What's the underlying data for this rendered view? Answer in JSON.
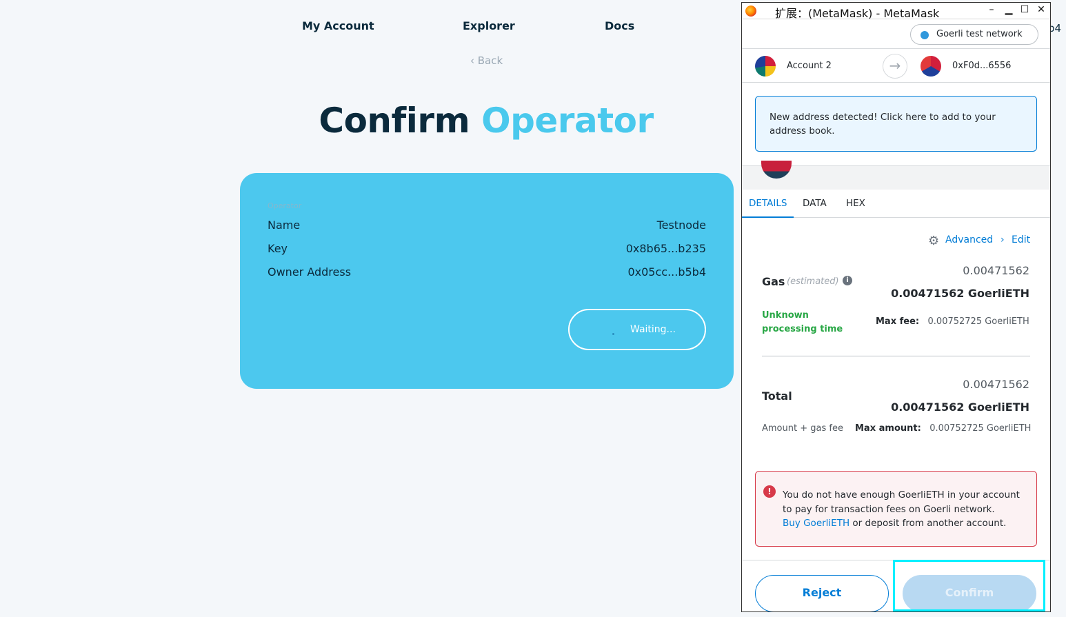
{
  "nav": {
    "my_account": "My Account",
    "explorer": "Explorer",
    "docs": "Docs",
    "back": "‹ Back"
  },
  "hero": {
    "word1": "Confirm",
    "word2": "Operator"
  },
  "card": {
    "section_label": "Operator",
    "rows": [
      {
        "key": "Name",
        "value": "Testnode"
      },
      {
        "key": "Key",
        "value": "0x8b65...b235"
      },
      {
        "key": "Owner Address",
        "value": "0x05cc...b5b4"
      }
    ],
    "waiting_label": "Waiting..."
  },
  "edge_text": "b4",
  "popup": {
    "title": "扩展：(MetaMask) - MetaMask",
    "controls": {
      "minimize": "–",
      "restore": "▁",
      "maximize": "☐",
      "close": "✕"
    },
    "network": "Goerli test network",
    "from_account": "Account 2",
    "to_account": "0xF0d...6556",
    "new_address_alert": "New address detected! Click here to add to your address book.",
    "tabs": [
      "DETAILS",
      "DATA",
      "HEX"
    ],
    "advanced": "Advanced",
    "edit": "Edit",
    "gas": {
      "label": "Gas",
      "estimated": "(estimated)",
      "value_fiat": "0.00471562",
      "value_eth": "0.00471562 GoerliETH",
      "processing": "Unknown processing time",
      "max_fee_label": "Max fee:",
      "max_fee_value": "0.00752725 GoerliETH"
    },
    "total": {
      "label": "Total",
      "value_fiat": "0.00471562",
      "value_eth": "0.00471562 GoerliETH",
      "sub": "Amount + gas fee",
      "max_amount_label": "Max amount:",
      "max_amount_value": "0.00752725 GoerliETH"
    },
    "error": {
      "line1": "You do not have enough GoerliETH in your account to pay for transaction fees on Goerli network.",
      "link": "Buy GoerliETH",
      "line2": " or deposit from another account."
    },
    "reject_label": "Reject",
    "confirm_label": "Confirm"
  },
  "colors": {
    "accent": "#4ac9ed",
    "card_bg": "#4cc8ee",
    "mm_blue": "#037dd6",
    "error_red": "#d73a49",
    "highlight": "#00f0ff"
  }
}
